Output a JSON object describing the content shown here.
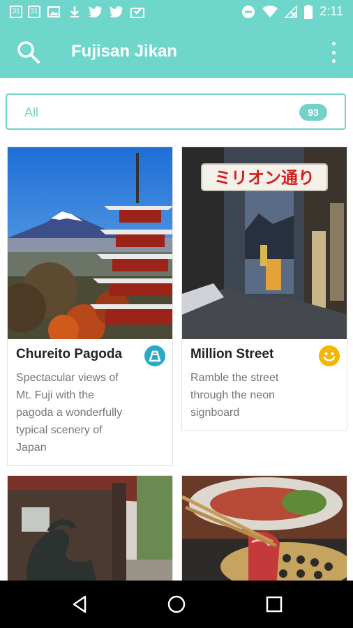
{
  "status_bar": {
    "time": "2:11",
    "notifications": [
      "calendar-31",
      "calendar-31",
      "image",
      "download",
      "twitter",
      "twitter",
      "inbox-check"
    ],
    "calendar_day": "31"
  },
  "app_bar": {
    "title": "Fujisan Jikan",
    "search_icon": "search-icon",
    "menu_icon": "overflow-menu-icon"
  },
  "filter": {
    "label": "All",
    "count": "93"
  },
  "cards": [
    {
      "title": "Chureito Pagoda",
      "description_lines": [
        "Spectacular views of",
        "Mt. Fuji with the",
        "pagoda a wonderfully",
        "typical scenery of",
        "Japan"
      ],
      "badge_icon": "mountain-icon",
      "badge_color": "#2aa9c6"
    },
    {
      "title": "Million Street",
      "description_lines": [
        "Ramble the street",
        "through the neon",
        "signboard"
      ],
      "badge_icon": "smiley-icon",
      "badge_color": "#f2b705",
      "sign_text": "ミリオン通り"
    }
  ],
  "colors": {
    "accent": "#6fd6cc",
    "filter_border": "#72d1c9"
  },
  "nav_bar": {
    "back": "back-icon",
    "home": "home-icon",
    "recents": "recents-icon"
  }
}
